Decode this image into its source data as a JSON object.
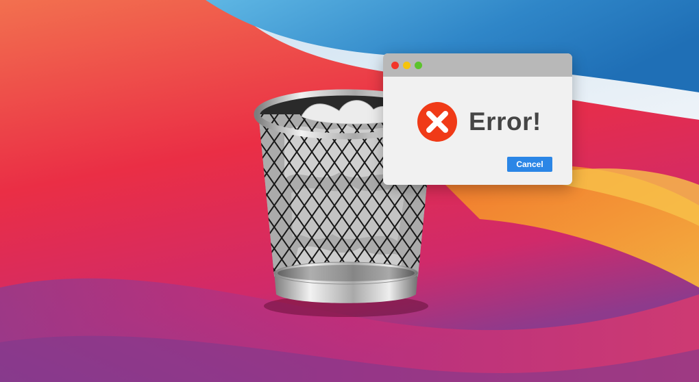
{
  "dialog": {
    "title": "Error!",
    "cancel_label": "Cancel",
    "icon": "error-x-icon",
    "traffic_lights": [
      "close",
      "minimize",
      "maximize"
    ]
  },
  "desktop": {
    "icon": "trash-bin-icon"
  },
  "colors": {
    "cancel_button": "#2b86e6",
    "error_icon": "#f03a17",
    "traffic_close": "#f2362a",
    "traffic_minimize": "#f5c40b",
    "traffic_maximize": "#5cc32c"
  }
}
